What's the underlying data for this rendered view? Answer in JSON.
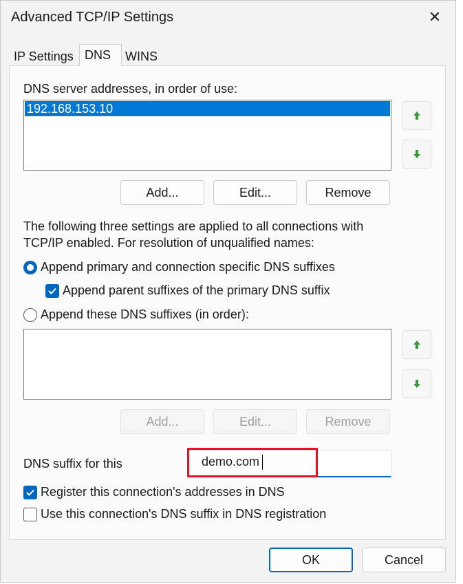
{
  "window": {
    "title": "Advanced TCP/IP Settings",
    "close_glyph": "✕"
  },
  "tabs": [
    {
      "label": "IP Settings",
      "active": false
    },
    {
      "label": "DNS",
      "active": true
    },
    {
      "label": "WINS",
      "active": false
    }
  ],
  "dns": {
    "servers_label": "DNS server addresses, in order of use:",
    "servers": [
      "192.168.153.10"
    ],
    "server_buttons": {
      "add": "Add...",
      "edit": "Edit...",
      "remove": "Remove"
    },
    "info_line1": "The following three settings are applied to all connections with",
    "info_line2": "TCP/IP enabled. For resolution of unqualified names:",
    "radio_primary": "Append primary and connection specific DNS suffixes",
    "check_parent": "Append parent suffixes of the primary DNS suffix",
    "radio_these": "Append these DNS suffixes (in order):",
    "suffix_buttons": {
      "add": "Add...",
      "edit": "Edit...",
      "remove": "Remove"
    },
    "suffix_label": "DNS suffix for this",
    "suffix_value": "demo.com",
    "check_register": "Register this connection's addresses in DNS",
    "check_use_suffix": "Use this connection's DNS suffix in DNS registration"
  },
  "footer": {
    "ok": "OK",
    "cancel": "Cancel"
  },
  "colors": {
    "accent": "#0067c0",
    "selection": "#0078d4",
    "highlight_box": "#e81123",
    "arrow_green": "#3a9a3a"
  },
  "icons": {
    "move_up": "arrow-up-icon",
    "move_down": "arrow-down-icon",
    "check": "checkmark-icon",
    "close": "close-icon"
  }
}
